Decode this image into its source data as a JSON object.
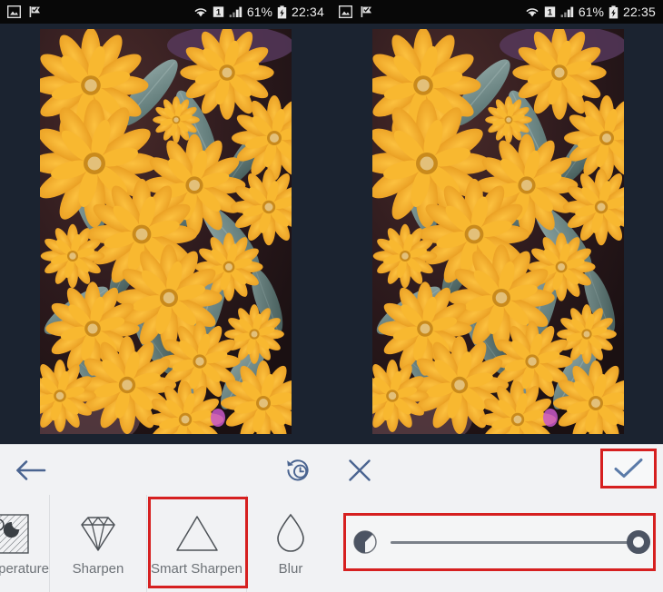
{
  "statusbar_left": {
    "icons": [
      "screenshot-icon",
      "flag-check-icon"
    ],
    "wifi": "wifi-icon",
    "sim": "1",
    "signal": "signal-bars-icon",
    "battery_pct": "61%",
    "battery": "battery-charging-icon",
    "time": "22:34"
  },
  "statusbar_right": {
    "icons": [
      "screenshot-icon",
      "flag-check-icon"
    ],
    "wifi": "wifi-icon",
    "sim": "1",
    "signal": "signal-bars-icon",
    "battery_pct": "61%",
    "battery": "battery-charging-icon",
    "time": "22:35"
  },
  "toolbar": {
    "back": "back-arrow-icon",
    "history": "history-revert-icon",
    "close": "close-x-icon",
    "apply": "apply-check-icon"
  },
  "filters": [
    {
      "label": "Temperature",
      "icon": "temperature-icon",
      "selected": false
    },
    {
      "label": "Sharpen",
      "icon": "diamond-icon",
      "selected": false
    },
    {
      "label": "Smart Sharpen",
      "icon": "triangle-icon",
      "selected": true
    },
    {
      "label": "Blur",
      "icon": "droplet-icon",
      "selected": false
    }
  ],
  "slider": {
    "icon": "half-contrast-icon",
    "value": 100,
    "min": 0,
    "max": 100
  },
  "colors": {
    "highlight": "#d62020",
    "toolbar_icon": "#4a6490",
    "bar_bg": "#f1f2f4",
    "label": "#6d7277",
    "photo_bg": "#1b2330",
    "slider_thumb": "#4c5463"
  },
  "photo": {
    "subject": "yellow zinnia flowers with teal-gray leaves",
    "left_caption": "original preview",
    "right_caption": "sharpened preview"
  }
}
